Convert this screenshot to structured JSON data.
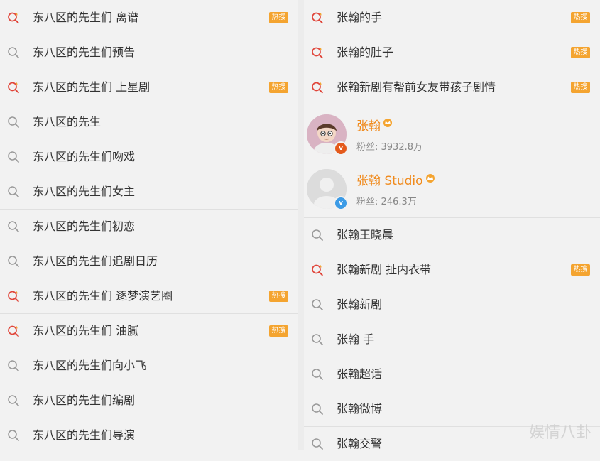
{
  "left": {
    "items": [
      {
        "label": "东八区的先生们 离谱",
        "hot": true
      },
      {
        "label": "东八区的先生们预告",
        "hot": false
      },
      {
        "label": "东八区的先生们 上星剧",
        "hot": true
      },
      {
        "label": "东八区的先生",
        "hot": false
      },
      {
        "label": "东八区的先生们吻戏",
        "hot": false
      },
      {
        "label": "东八区的先生们女主",
        "hot": false
      },
      {
        "label": "东八区的先生们初恋",
        "hot": false
      },
      {
        "label": "东八区的先生们追剧日历",
        "hot": false
      },
      {
        "label": "东八区的先生们 逐梦演艺圈",
        "hot": true
      },
      {
        "label": "东八区的先生们 油腻",
        "hot": true
      },
      {
        "label": "东八区的先生们向小飞",
        "hot": false
      },
      {
        "label": "东八区的先生们编剧",
        "hot": false
      },
      {
        "label": "东八区的先生们导演",
        "hot": false
      }
    ]
  },
  "right": {
    "top_items": [
      {
        "label": "张翰的手",
        "hot": true
      },
      {
        "label": "张翰的肚子",
        "hot": true
      },
      {
        "label": "张翰新剧有帮前女友带孩子剧情",
        "hot": true
      }
    ],
    "users": [
      {
        "name": "张翰",
        "fans": "粉丝: 3932.8万",
        "verify_color": "#e45a1c"
      },
      {
        "name": "张翰 Studio",
        "fans": "粉丝: 246.3万",
        "verify_color": "#3c9be6"
      }
    ],
    "bottom_items": [
      {
        "label": "张翰王晓晨",
        "hot": false
      },
      {
        "label": "张翰新剧 扯内衣带",
        "hot": true
      },
      {
        "label": "张翰新剧",
        "hot": false
      },
      {
        "label": "张翰 手",
        "hot": false
      },
      {
        "label": "张翰超话",
        "hot": false
      },
      {
        "label": "张翰微博",
        "hot": false
      },
      {
        "label": "张翰交警",
        "hot": false
      }
    ]
  },
  "badge_text": "热搜",
  "watermark": "娱情八卦",
  "colors": {
    "accent": "#f08a1c",
    "badge": "#f4a430",
    "hot_icon": "#e0453a"
  }
}
